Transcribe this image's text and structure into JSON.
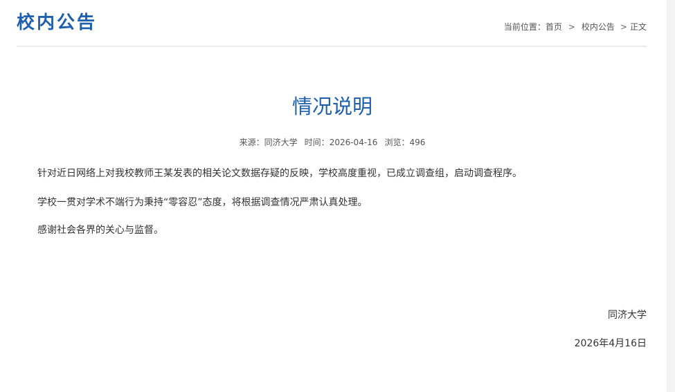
{
  "header": {
    "section_title": "校内公告",
    "breadcrumb": {
      "prefix": "当前位置：",
      "home": "首页",
      "separator": ">",
      "section": "校内公告",
      "current": "正文"
    }
  },
  "article": {
    "title": "情况说明",
    "meta": {
      "source_label": "来源：",
      "source": "同济大学",
      "time_label": "时间：",
      "time": "2026-04-16",
      "views_label": "浏览：",
      "views": "496"
    },
    "paragraphs": [
      "针对近日网络上对我校教师王某发表的相关论文数据存疑的反映，学校高度重视，已成立调查组，启动调查程序。",
      "学校一贯对学术不端行为秉持“零容忍”态度，将根据调查情况严肃认真处理。",
      "感谢社会各界的关心与监督。"
    ],
    "signature": {
      "org": "同济大学",
      "date": "2026年4月16日"
    }
  }
}
